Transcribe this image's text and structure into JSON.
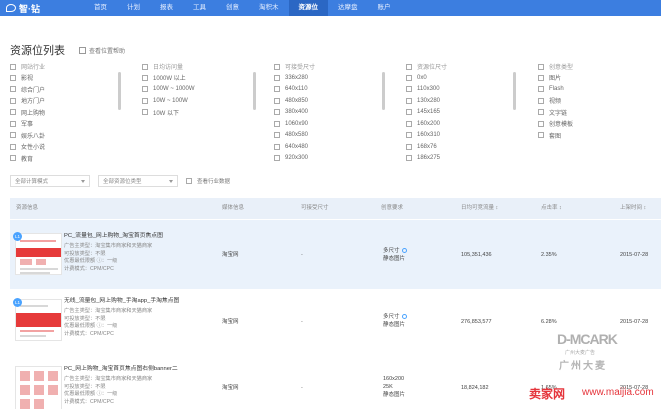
{
  "brand": "智·钻",
  "nav": [
    {
      "label": "首页",
      "active": false
    },
    {
      "label": "计划",
      "active": false
    },
    {
      "label": "报表",
      "active": false
    },
    {
      "label": "工具",
      "active": false
    },
    {
      "label": "创意",
      "active": false
    },
    {
      "label": "淘积木",
      "active": false
    },
    {
      "label": "资源位",
      "active": true
    },
    {
      "label": "达摩盘",
      "active": false
    },
    {
      "label": "账户",
      "active": false
    }
  ],
  "page_title": "资源位列表",
  "help_label": "查看位置帮助",
  "filters": [
    {
      "head": "网站行业",
      "options": [
        "影视",
        "综合门户",
        "地方门户",
        "网上购物",
        "军事",
        "娱乐八卦",
        "女性小说",
        "教育"
      ]
    },
    {
      "head": "日均访问量",
      "options": [
        "1000W 以上",
        "100W ~ 1000W",
        "10W ~ 100W",
        "10W 以下"
      ]
    },
    {
      "head": "可接受尺寸",
      "options": [
        "336x280",
        "640x110",
        "480x850",
        "380x400",
        "1060x90",
        "480x580",
        "640x480",
        "920x300"
      ]
    },
    {
      "head": "资源位尺寸",
      "options": [
        "0x0",
        "110x300",
        "130x280",
        "145x165",
        "160x200",
        "160x310",
        "168x76",
        "186x275"
      ]
    },
    {
      "head": "创意类型",
      "options": [
        "图片",
        "Flash",
        "视频",
        "文字链",
        "创意模板",
        "套图"
      ]
    }
  ],
  "selects": {
    "calc": "全部计算模式",
    "type": "全部资源位类型",
    "industry_check": "查看行业数据"
  },
  "table": {
    "headers": [
      "资源信息",
      "媒体信息",
      "可接受尺寸",
      "创意要求",
      "日均可竞流量 ↕",
      "点击率 ↕",
      "上架时间 ↕"
    ],
    "rows": [
      {
        "badge": "L1",
        "name": "PC_流量包_网上购物_淘宝首页焦点图",
        "lines": [
          "广告主类型：淘宝集市商家和天猫商家",
          "可投放类型：不限",
          "优惠最低限额 ⓘ：一级",
          "计费模式：CPM/CPC"
        ],
        "media": "淘宝网",
        "size": "-",
        "req": [
          "多尺寸",
          "静态图片"
        ],
        "traffic": "105,351,436",
        "ctr": "2.35%",
        "date": "2015-07-28"
      },
      {
        "badge": "L1",
        "name": "无线_流量包_网上购物_手淘app_手淘焦点图",
        "lines": [
          "广告主类型：淘宝集市商家和天猫商家",
          "可投放类型：不限",
          "优惠最低限额 ⓘ：一级",
          "计费模式：CPM/CPC"
        ],
        "media": "淘宝网",
        "size": "-",
        "req": [
          "多尺寸",
          "静态图片"
        ],
        "traffic": "276,853,577",
        "ctr": "6.28%",
        "date": "2015-07-28"
      },
      {
        "badge": "",
        "name": "PC_网上购物_淘宝首页焦点图右侧banner二",
        "lines": [
          "广告主类型：淘宝集市商家和天猫商家",
          "可投放类型：不限",
          "优惠最低限额 ⓘ：一级",
          "计费模式：CPM/CPC"
        ],
        "media": "淘宝网",
        "size": "-",
        "req": [
          "160x200",
          "25K",
          "静态图片"
        ],
        "traffic": "18,824,182",
        "ctr": "1.65%",
        "date": "2015-07-28"
      }
    ]
  },
  "watermark": {
    "logo": "D-MCARK",
    "sub": "广州大麦广告",
    "city": "广州大麦",
    "site": "卖家网",
    "url": "www.maijia.com"
  }
}
